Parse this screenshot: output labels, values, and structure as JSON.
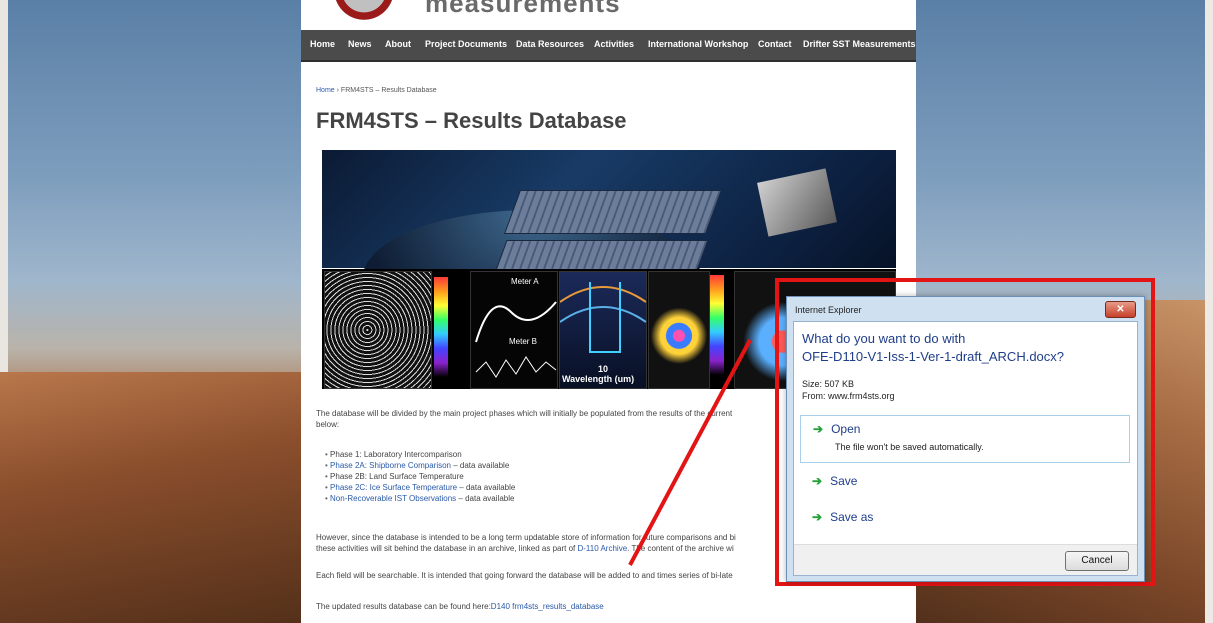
{
  "site": {
    "logo_text": "measurements"
  },
  "nav": [
    "Home",
    "News",
    "About",
    "Project Documents",
    "Data Resources",
    "Activities",
    "International Workshop",
    "Contact",
    "Drifter SST Measurements"
  ],
  "breadcrumb": {
    "home": "Home",
    "sep": " › ",
    "current": "FRM4STS – Results Database"
  },
  "page_title": "FRM4STS – Results Database",
  "graph_label": "Wavelength (um)",
  "graph_labels": {
    "meter_a": "Meter A",
    "meter_b": "Meter B",
    "ten": "10"
  },
  "intro": "The database will be divided by the main project phases which will initially be populated from the results of the current",
  "intro2": "below:",
  "phases": [
    {
      "text": "Phase 1: Laboratory Intercomparison",
      "link": "",
      "tail": ""
    },
    {
      "text": "",
      "link": "Phase 2A: Shipborne Comparison",
      "tail": " – data available"
    },
    {
      "text": "Phase 2B: Land Surface Temperature",
      "link": "",
      "tail": ""
    },
    {
      "text": "",
      "link": "Phase 2C: Ice Surface Temperature",
      "tail": " – data available"
    },
    {
      "text": "",
      "link": "Non-Recoverable IST Observations",
      "tail": " – data available"
    }
  ],
  "para2a": "However, since the database is intended to be a long term updatable store of information for future comparisons and bi",
  "para2b": "these activities will sit behind the database in an archive, linked as part of ",
  "para2b_link": "D-110 Archive",
  "para2b_tail": ". The content of the archive wi",
  "para3": "Each field will be searchable. It is intended that going forward the database will be added to and times series of bi-late",
  "para4": "The updated results database can be found here:",
  "para4_link": "D140 frm4sts_results_database",
  "dialog": {
    "title": "Internet Explorer",
    "close": "✕",
    "question": "What do you want to do with",
    "filename": "OFE-D110-V1-Iss-1-Ver-1-draft_ARCH.docx?",
    "size": "Size: 507 KB",
    "from": "From: www.frm4sts.org",
    "open": "Open",
    "open_sub": "The file won't be saved automatically.",
    "save": "Save",
    "save_as": "Save as",
    "cancel": "Cancel"
  },
  "colors": {
    "annotation": "#e31414",
    "nav_bg": "#4b4b4b",
    "link": "#2a5aa8",
    "dialog_text": "#1f3e8a"
  }
}
